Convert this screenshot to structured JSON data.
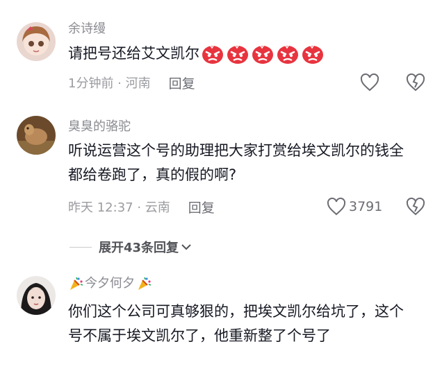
{
  "comments": [
    {
      "user": "余诗缦",
      "text": "请把号还给艾文凯尔",
      "emoji_name": "angry-face-emoji",
      "emoji_count": 5,
      "time": "1分钟前 · 河南",
      "reply": "回复",
      "likes": ""
    },
    {
      "user": "臭臭的骆驼",
      "text": "听说运营这个号的助理把大家打赏给埃文凯尔的钱全都给卷跑了，真的假的啊?",
      "time": "昨天 12:37 · 云南",
      "reply": "回复",
      "likes": "3791"
    },
    {
      "user": "今夕何夕",
      "user_decoration": "party-popper-icon",
      "text": "你们这个公司可真够狠的，把埃文凯尔给坑了，这个号不属于埃文凯尔了，他重新整了个号了"
    }
  ],
  "expand": {
    "label": "展开43条回复"
  },
  "colors": {
    "name": "#8a8b91",
    "meta": "#9a9ba0",
    "text": "#161823",
    "emoji": "#e8343f"
  }
}
